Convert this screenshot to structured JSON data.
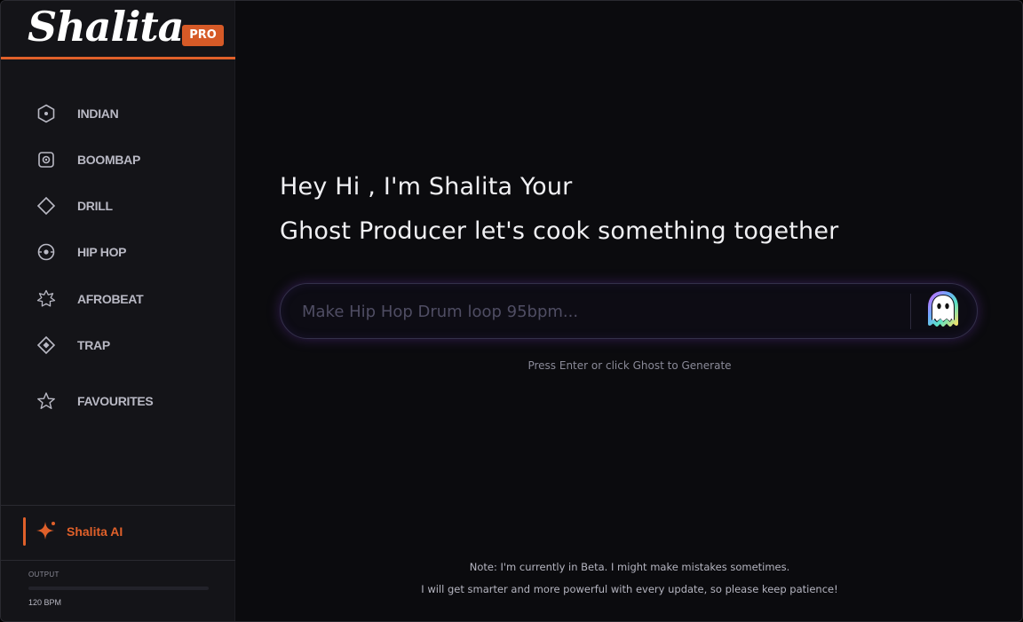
{
  "brand": {
    "name": "Shalita",
    "badge": "PRO",
    "accent": "#e0602a"
  },
  "sidebar": {
    "items": [
      {
        "label": "INDIAN",
        "icon": "hexagon-dot-icon"
      },
      {
        "label": "BOOMBAP",
        "icon": "speaker-icon"
      },
      {
        "label": "DRILL",
        "icon": "diamond-icon"
      },
      {
        "label": "HIP HOP",
        "icon": "disc-icon"
      },
      {
        "label": "AFROBEAT",
        "icon": "sun-burst-icon"
      },
      {
        "label": "TRAP",
        "icon": "diamond-dot-icon"
      },
      {
        "label": "FAVOURITES",
        "icon": "star-icon"
      }
    ],
    "ai": {
      "label": "Shalita AI",
      "icon": "sparkle-icon"
    },
    "output": {
      "label": "OUTPUT",
      "level": 0,
      "bpm": "120 BPM"
    }
  },
  "main": {
    "headline_line1": "Hey Hi , I'm Shalita Your",
    "headline_line2": "Ghost Producer let's cook something together",
    "prompt": {
      "placeholder": "Make Hip Hop Drum loop 95bpm...",
      "value": ""
    },
    "generate_button_icon": "ghost-icon",
    "hint": "Press Enter or click Ghost to Generate",
    "note_line1": "Note: I'm currently in Beta. I might make mistakes sometimes.",
    "note_line2": "I will get smarter and more powerful with every update, so please keep patience!"
  }
}
